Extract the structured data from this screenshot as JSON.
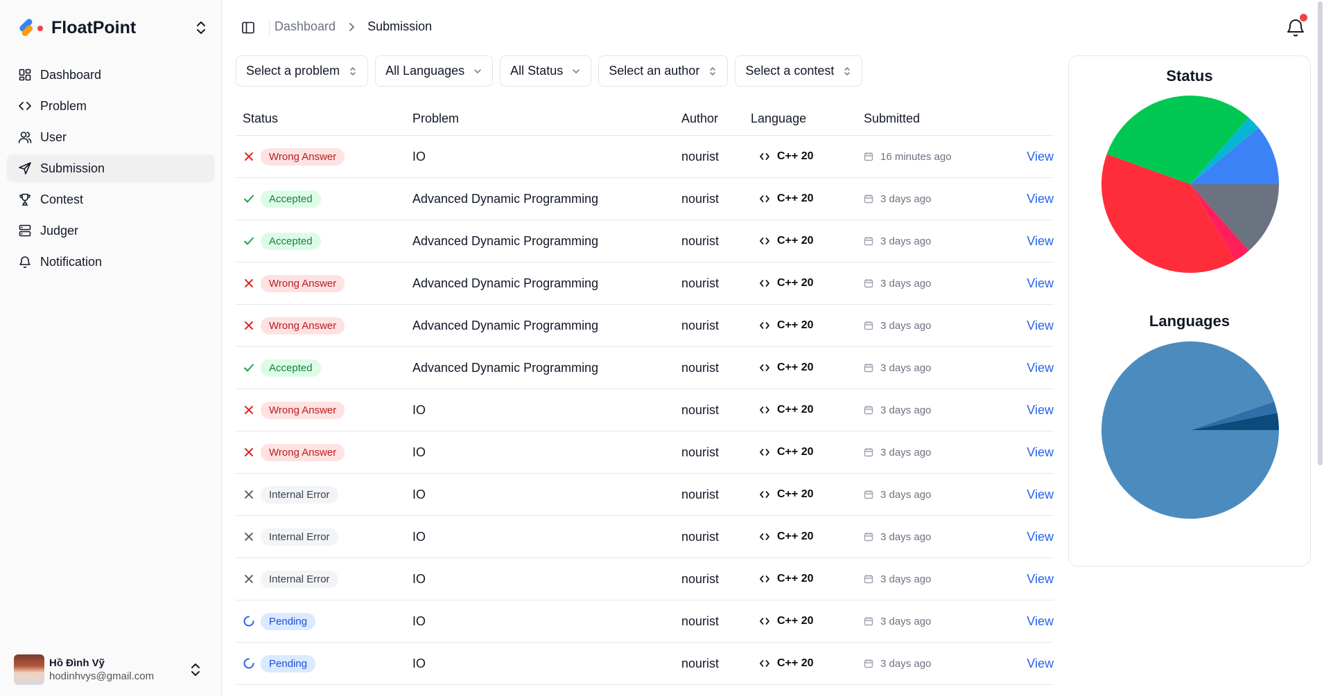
{
  "app": {
    "name": "FloatPoint"
  },
  "sidebar": {
    "items": [
      {
        "label": "Dashboard",
        "icon": "dashboard-icon",
        "active": false
      },
      {
        "label": "Problem",
        "icon": "code-icon",
        "active": false
      },
      {
        "label": "User",
        "icon": "users-icon",
        "active": false
      },
      {
        "label": "Submission",
        "icon": "send-icon",
        "active": true
      },
      {
        "label": "Contest",
        "icon": "trophy-icon",
        "active": false
      },
      {
        "label": "Judger",
        "icon": "server-icon",
        "active": false
      },
      {
        "label": "Notification",
        "icon": "bell-icon",
        "active": false
      }
    ]
  },
  "user": {
    "name": "Hồ Đình Vỹ",
    "email": "hodinhvys@gmail.com"
  },
  "breadcrumb": {
    "parent": "Dashboard",
    "current": "Submission"
  },
  "filters": {
    "problem": "Select a problem",
    "language": "All Languages",
    "status": "All Status",
    "author": "Select an author",
    "contest": "Select a contest"
  },
  "table": {
    "headers": {
      "status": "Status",
      "problem": "Problem",
      "author": "Author",
      "language": "Language",
      "submitted": "Submitted"
    },
    "view_label": "View",
    "rows": [
      {
        "status": "Wrong Answer",
        "kind": "wrong",
        "problem": "IO",
        "author": "nourist",
        "language": "C++ 20",
        "submitted": "16 minutes ago"
      },
      {
        "status": "Accepted",
        "kind": "accepted",
        "problem": "Advanced Dynamic Programming",
        "author": "nourist",
        "language": "C++ 20",
        "submitted": "3 days ago"
      },
      {
        "status": "Accepted",
        "kind": "accepted",
        "problem": "Advanced Dynamic Programming",
        "author": "nourist",
        "language": "C++ 20",
        "submitted": "3 days ago"
      },
      {
        "status": "Wrong Answer",
        "kind": "wrong",
        "problem": "Advanced Dynamic Programming",
        "author": "nourist",
        "language": "C++ 20",
        "submitted": "3 days ago"
      },
      {
        "status": "Wrong Answer",
        "kind": "wrong",
        "problem": "Advanced Dynamic Programming",
        "author": "nourist",
        "language": "C++ 20",
        "submitted": "3 days ago"
      },
      {
        "status": "Accepted",
        "kind": "accepted",
        "problem": "Advanced Dynamic Programming",
        "author": "nourist",
        "language": "C++ 20",
        "submitted": "3 days ago"
      },
      {
        "status": "Wrong Answer",
        "kind": "wrong",
        "problem": "IO",
        "author": "nourist",
        "language": "C++ 20",
        "submitted": "3 days ago"
      },
      {
        "status": "Wrong Answer",
        "kind": "wrong",
        "problem": "IO",
        "author": "nourist",
        "language": "C++ 20",
        "submitted": "3 days ago"
      },
      {
        "status": "Internal Error",
        "kind": "internal",
        "problem": "IO",
        "author": "nourist",
        "language": "C++ 20",
        "submitted": "3 days ago"
      },
      {
        "status": "Internal Error",
        "kind": "internal",
        "problem": "IO",
        "author": "nourist",
        "language": "C++ 20",
        "submitted": "3 days ago"
      },
      {
        "status": "Internal Error",
        "kind": "internal",
        "problem": "IO",
        "author": "nourist",
        "language": "C++ 20",
        "submitted": "3 days ago"
      },
      {
        "status": "Pending",
        "kind": "pending",
        "problem": "IO",
        "author": "nourist",
        "language": "C++ 20",
        "submitted": "3 days ago"
      },
      {
        "status": "Pending",
        "kind": "pending",
        "problem": "IO",
        "author": "nourist",
        "language": "C++ 20",
        "submitted": "3 days ago"
      }
    ]
  },
  "colors": {
    "wrong": "#dc2626",
    "accepted": "#16a34a",
    "internal": "#52525b",
    "pending": "#2563eb",
    "link": "#2563eb"
  },
  "chart_data": [
    {
      "type": "pie",
      "title": "Status",
      "slices": [
        {
          "value": 11.0,
          "color": "#3b82f6"
        },
        {
          "value": 2.5,
          "color": "#06b6d4"
        },
        {
          "value": 31.0,
          "color": "#00c853"
        },
        {
          "value": 39.0,
          "color": "#ff2d3a"
        },
        {
          "value": 3.0,
          "color": "#ff1f5a"
        },
        {
          "value": 13.5,
          "color": "#6b7280"
        }
      ]
    },
    {
      "type": "pie",
      "title": "Languages",
      "slices": [
        {
          "value": 3.0,
          "color": "#0b4a7a"
        },
        {
          "value": 2.0,
          "color": "#2e6fa7"
        },
        {
          "value": 91.0,
          "color": "#4c8bbd"
        }
      ]
    }
  ]
}
